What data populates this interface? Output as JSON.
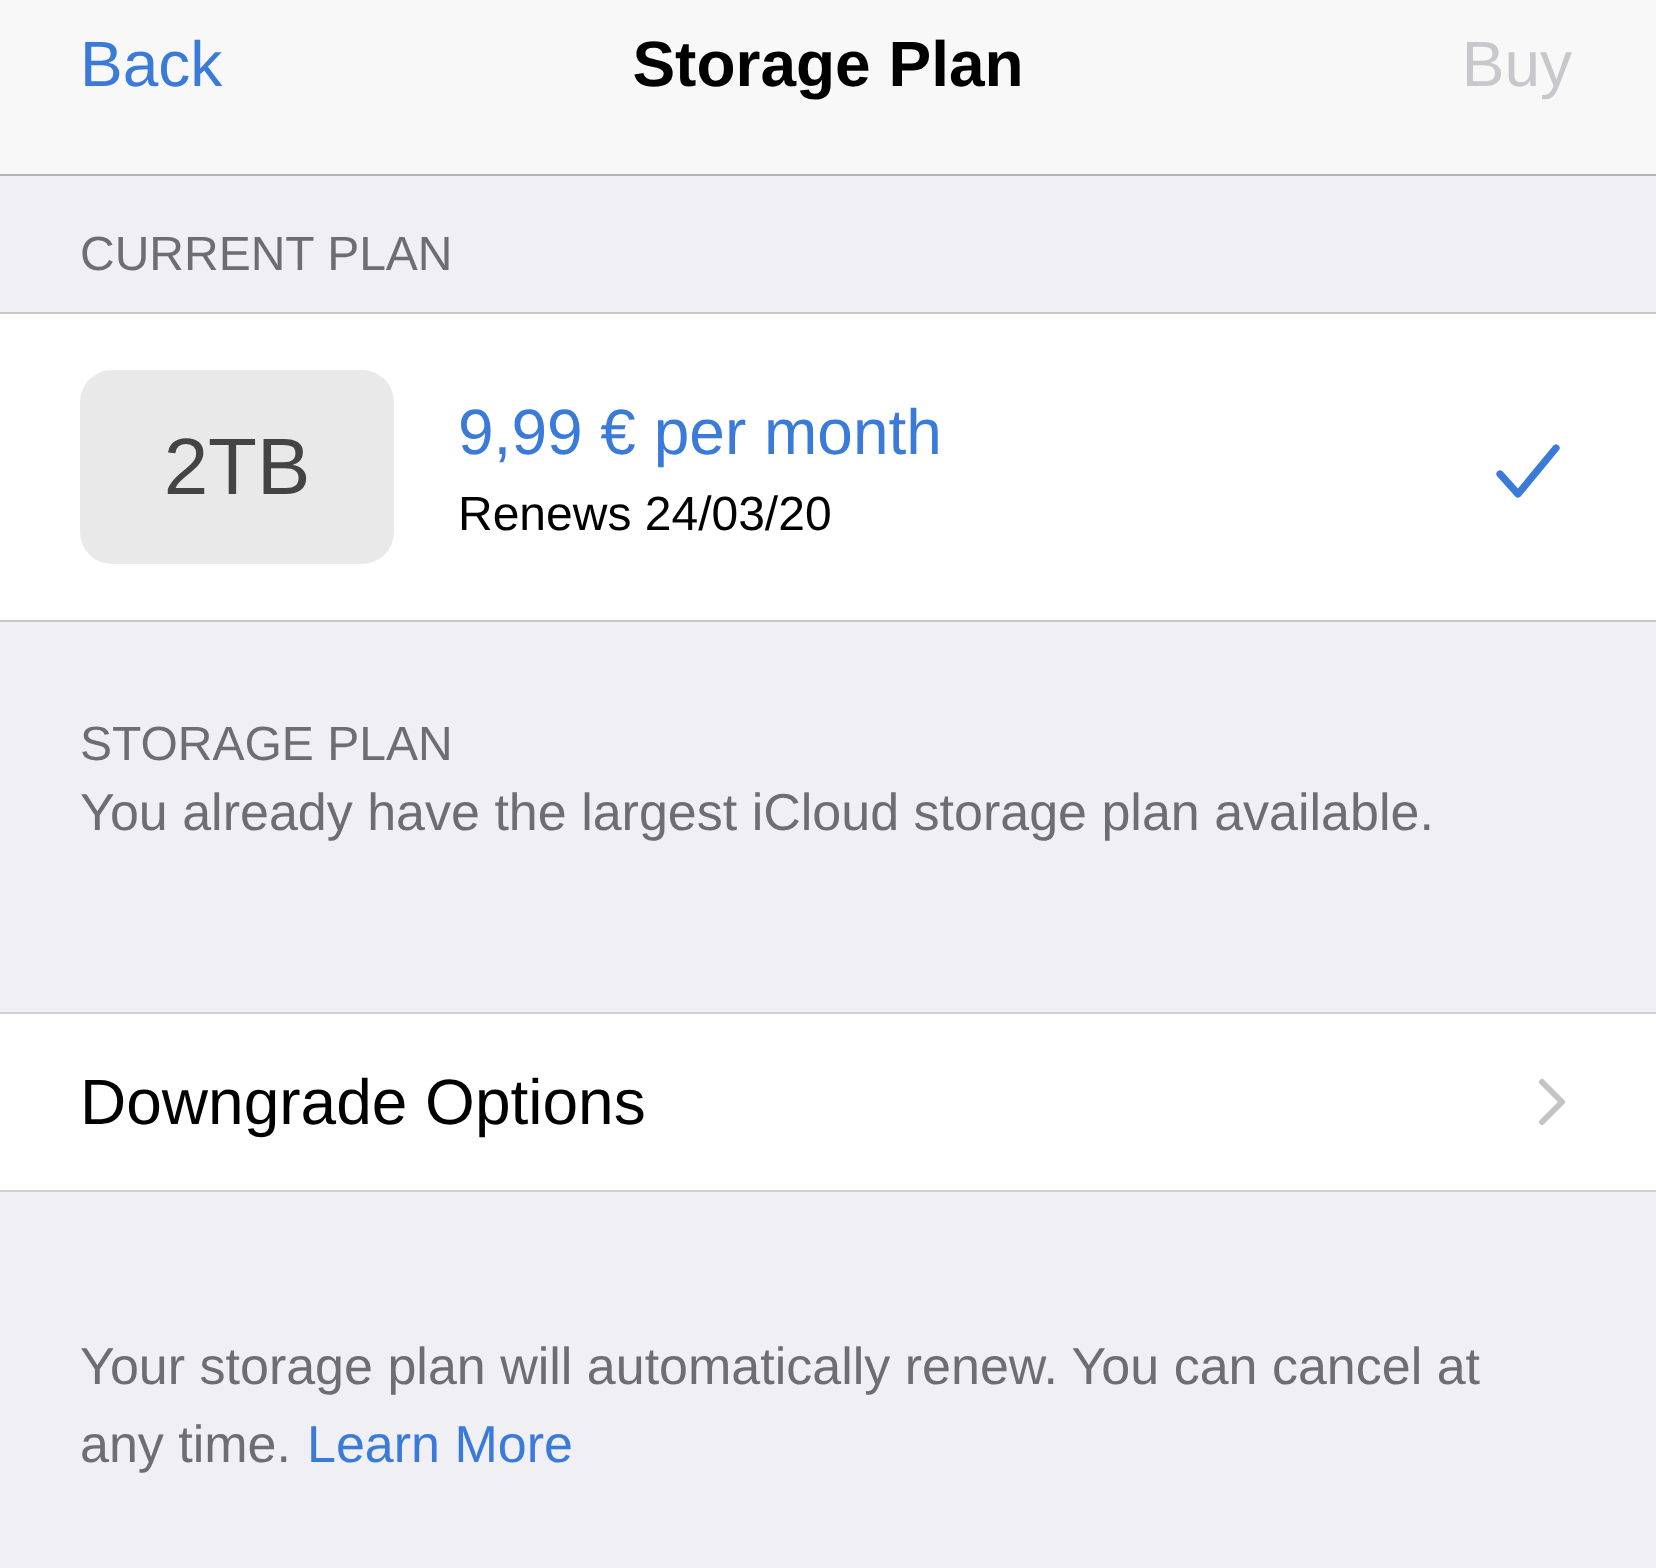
{
  "nav_bar": {
    "back": "Back",
    "title": "Storage Plan",
    "buy": {
      "label": "Buy",
      "disabled": true
    }
  },
  "current_plan": {
    "header": "CURRENT PLAN",
    "plan": {
      "size": "2TB",
      "price": "9,99 € per month",
      "renews": "Renews 24/03/20",
      "selected": true
    }
  },
  "storage_plan": {
    "header": "STORAGE PLAN",
    "description": "You already have the largest iCloud storage plan available."
  },
  "downgrade_row": {
    "label": "Downgrade Options"
  },
  "footer": {
    "text": "Your storage plan will automatically renew. You can cancel at any time.",
    "link": "Learn More"
  }
}
